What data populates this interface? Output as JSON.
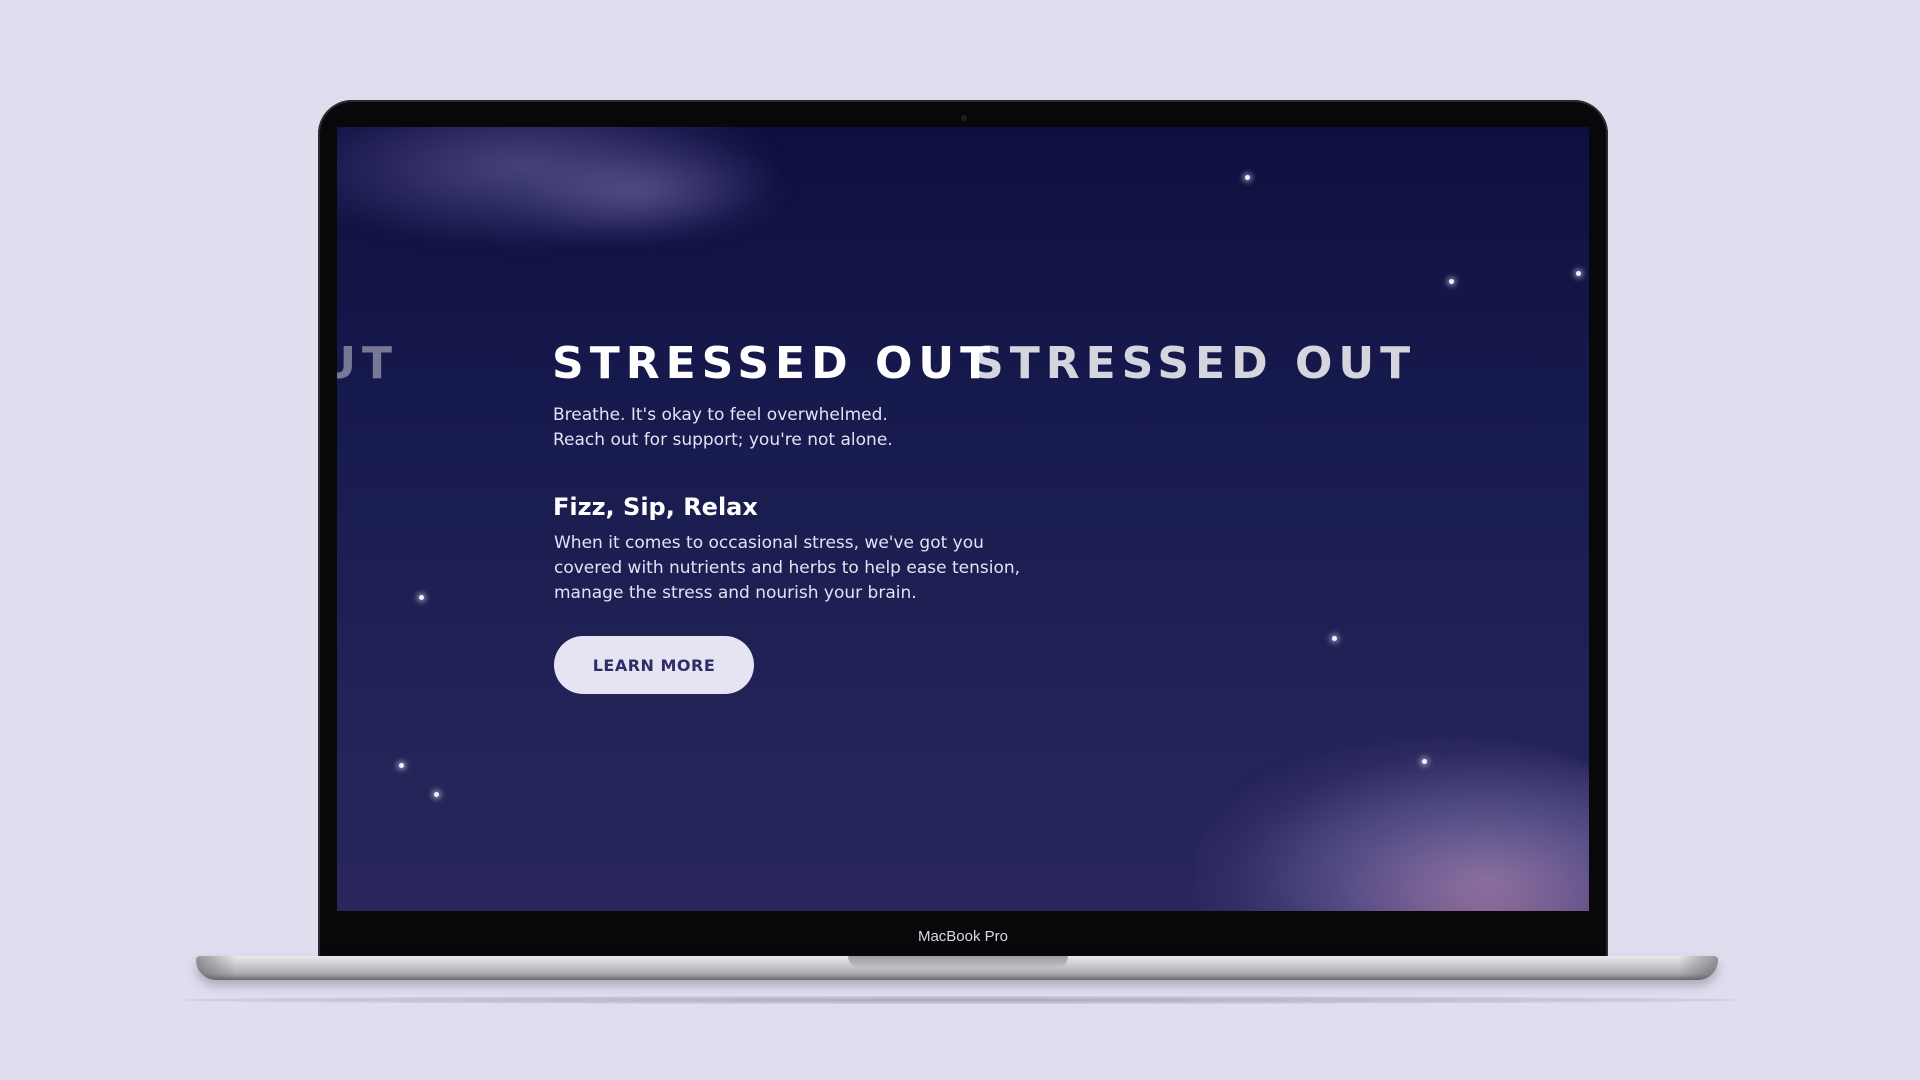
{
  "hero": {
    "marquee": {
      "faded_text": "ED OUT",
      "main_text": "STRESSED OUT",
      "next_text": "STRESSED OUT"
    },
    "tagline_line1": "Breathe. It's okay to feel overwhelmed.",
    "tagline_line2": "Reach out for support; you're not alone."
  },
  "section": {
    "title": "Fizz, Sip, Relax",
    "body_line1": "When it comes to occasional stress, we've got you",
    "body_line2": "covered with nutrients and herbs to help ease tension,",
    "body_line3": "manage the stress and nourish your brain."
  },
  "cta": {
    "label": "LEARN MORE"
  },
  "device": {
    "model_label": "MacBook Pro"
  },
  "colors": {
    "page_background": "#dfdeef",
    "screen_top": "#0f0f3f",
    "screen_bottom": "#29275b",
    "button_background": "#e6e3f3",
    "button_text": "#2e2d66"
  }
}
